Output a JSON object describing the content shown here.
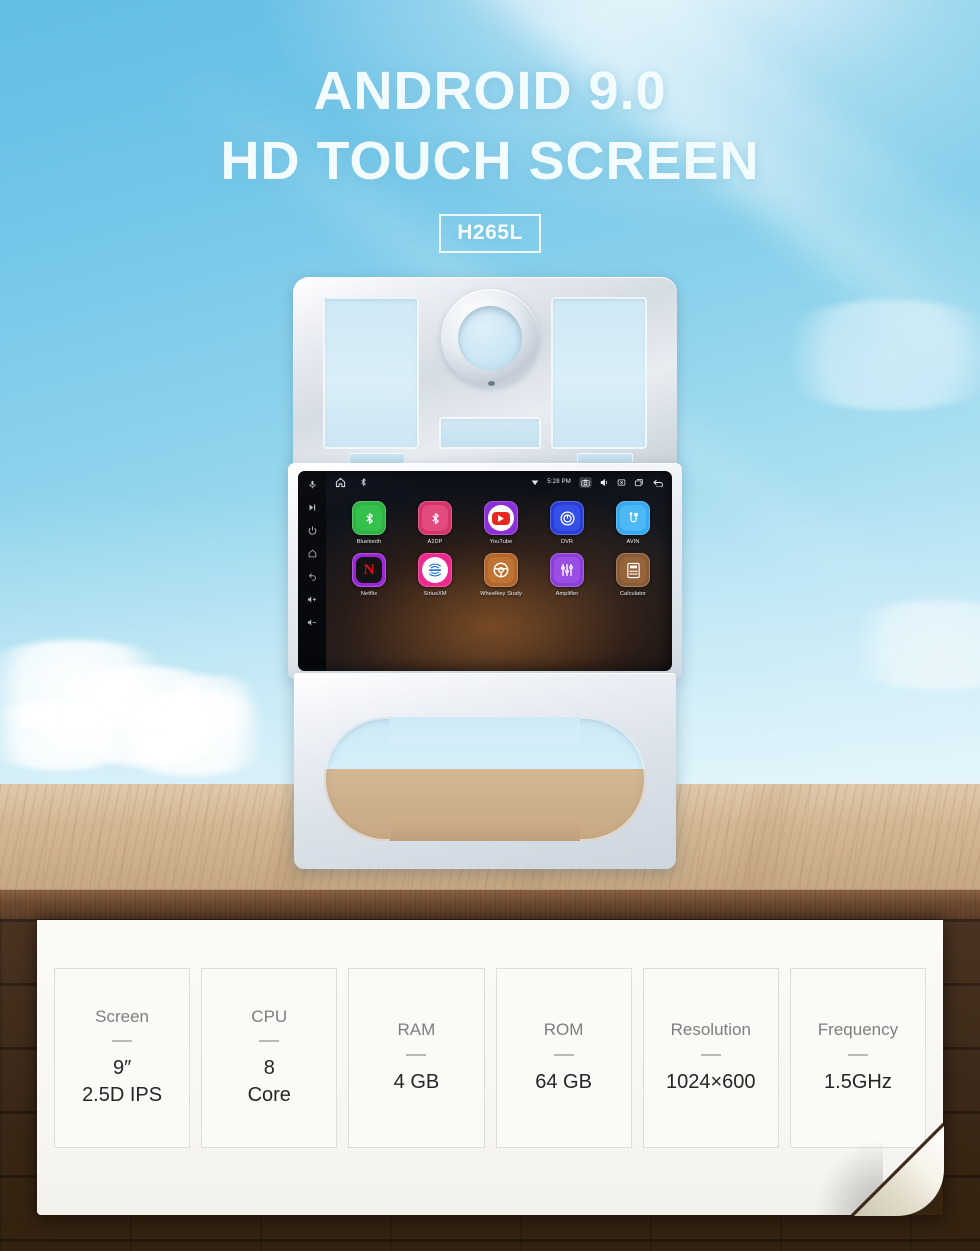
{
  "hero": {
    "headline_line1": "ANDROID 9.0",
    "headline_line2": "HD TOUCH SCREEN",
    "badge": "H265L"
  },
  "device": {
    "statusbar": {
      "home_icon": "home-icon",
      "bluetooth_icon": "bluetooth-icon",
      "signal_icon": "signal-icon",
      "time": "5:28 PM",
      "camera_icon": "camera-icon",
      "volume_icon": "volume-icon",
      "close_icon": "close-box-icon",
      "recents_icon": "recents-icon",
      "back_icon": "back-arrow-icon"
    },
    "side_buttons": [
      {
        "name": "mic-button",
        "glyph": "mic"
      },
      {
        "name": "next-button",
        "glyph": "next"
      },
      {
        "name": "power-button",
        "glyph": "power"
      },
      {
        "name": "home-button",
        "glyph": "home"
      },
      {
        "name": "back-button",
        "glyph": "back"
      },
      {
        "name": "volume-up-button",
        "glyph": "vol-up"
      },
      {
        "name": "volume-down-button",
        "glyph": "vol-down"
      }
    ],
    "apps": [
      {
        "label": "Bluetooth",
        "tile_color": "#2fb344",
        "inner_color": "#34c24d",
        "glyph": "bluetooth"
      },
      {
        "label": "A2DP",
        "tile_color": "#d6336c",
        "inner_color": "#e34a7d",
        "glyph": "bluetooth"
      },
      {
        "label": "YouTube",
        "tile_color": "#8b2fd6",
        "inner_color": "#ffffff",
        "glyph": "youtube"
      },
      {
        "label": "DVR",
        "tile_color": "#2b3fd6",
        "inner_color": "#3550e8",
        "glyph": "dvr"
      },
      {
        "label": "AVIN",
        "tile_color": "#36a9f0",
        "inner_color": "#4cb8f5",
        "glyph": "avin"
      },
      {
        "label": "Netflix",
        "tile_color": "#9b27d6",
        "inner_color": "#1a1a1a",
        "glyph": "netflix"
      },
      {
        "label": "SiriusXM",
        "tile_color": "#ec2a8e",
        "inner_color": "#ffffff",
        "glyph": "siriusxm"
      },
      {
        "label": "Wheelkey Study",
        "tile_color": "#b3662c",
        "inner_color": "#c07434",
        "glyph": "steering"
      },
      {
        "label": "Amplifier",
        "tile_color": "#8b3fd6",
        "inner_color": "#9a4ee3",
        "glyph": "equalizer"
      },
      {
        "label": "Calculator",
        "tile_color": "#8a5a34",
        "inner_color": "#96643b",
        "glyph": "calculator"
      }
    ]
  },
  "specs": [
    {
      "label": "Screen",
      "value": "9″\n2.5D IPS"
    },
    {
      "label": "CPU",
      "value": "8\nCore"
    },
    {
      "label": "RAM",
      "value": "4 GB"
    },
    {
      "label": "ROM",
      "value": "64 GB"
    },
    {
      "label": "Resolution",
      "value": "1024×600"
    },
    {
      "label": "Frequency",
      "value": "1.5GHz"
    }
  ],
  "colors": {
    "sky": "#72c6e8",
    "wood_top": "#d3b793",
    "wood_edge": "#6f4c31",
    "floor": "#3b2818",
    "card": "#faf9f6"
  }
}
